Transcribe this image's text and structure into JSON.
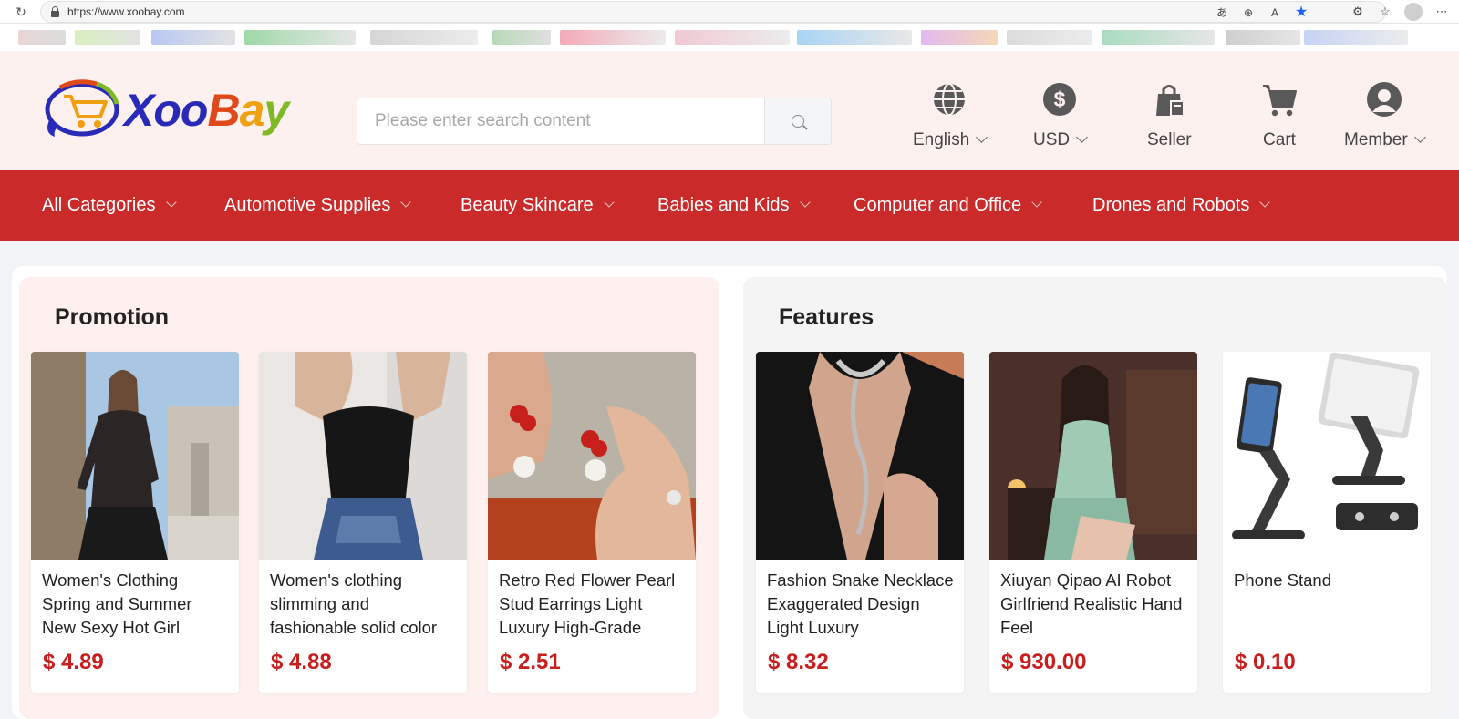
{
  "browser": {
    "url": "https://www.xoobay.com"
  },
  "brand": {
    "name_x": "X",
    "name_oo": "oo",
    "name_b": "B",
    "name_a": "a",
    "name_y": "y",
    "accent_red": "#cb2a2a",
    "price_red": "#c81e1e"
  },
  "search": {
    "placeholder": "Please enter search content",
    "icon": "search-icon"
  },
  "header_items": {
    "language": {
      "label": "English",
      "icon": "globe-icon"
    },
    "currency": {
      "label": "USD",
      "icon": "dollar-icon"
    },
    "seller": {
      "label": "Seller",
      "icon": "shopping-bag-icon"
    },
    "cart": {
      "label": "Cart",
      "icon": "cart-icon"
    },
    "member": {
      "label": "Member",
      "icon": "user-icon"
    }
  },
  "categories": [
    "All Categories",
    "Automotive Supplies",
    "Beauty Skincare",
    "Babies and Kids",
    "Computer and Office",
    "Drones and Robots"
  ],
  "promotion": {
    "title": "Promotion",
    "products": [
      {
        "title": "Women's Clothing Spring and Summer New Sexy Hot Girl",
        "price": "$ 4.89"
      },
      {
        "title": "Women's clothing slimming and fashionable solid color",
        "price": "$ 4.88"
      },
      {
        "title": "Retro Red Flower Pearl Stud Earrings Light Luxury High-Grade",
        "price": "$ 2.51"
      }
    ]
  },
  "features": {
    "title": "Features",
    "products": [
      {
        "title": "Fashion Snake Necklace Exaggerated Design Light Luxury",
        "price": "$ 8.32"
      },
      {
        "title": "Xiuyan Qipao AI Robot Girlfriend Realistic Hand Feel",
        "price": "$ 930.00"
      },
      {
        "title": "Phone Stand",
        "price": "$ 0.10"
      }
    ]
  }
}
